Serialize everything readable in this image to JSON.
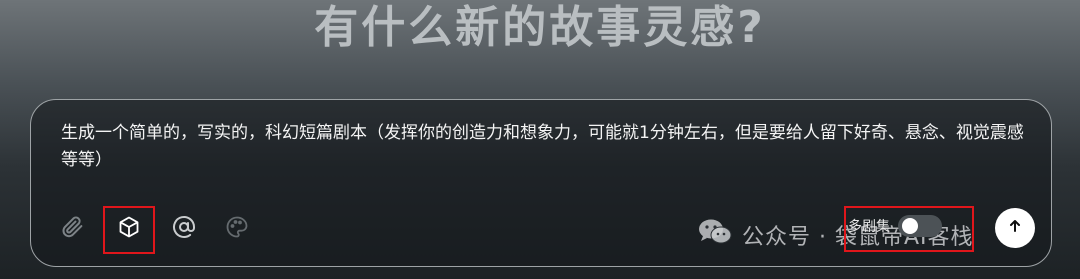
{
  "headline": "有什么新的故事灵感?",
  "composer": {
    "prompt_text": "生成一个简单的，写实的，科幻短篇剧本（发挥你的创造力和想象力，可能就1分钟左右，但是要给人留下好奇、悬念、视觉震感等等）",
    "tools": [
      {
        "icon": "paperclip-icon",
        "highlighted": false
      },
      {
        "icon": "cube-icon",
        "highlighted": true
      },
      {
        "icon": "at-sign-icon",
        "highlighted": false
      },
      {
        "icon": "palette-icon",
        "highlighted": false
      }
    ],
    "mode_toggle": {
      "label": "多剧集",
      "on": false,
      "highlighted": true
    },
    "send_icon": "arrow-up-icon"
  },
  "watermark": {
    "text": "公众号 · 袋鼠帝AI客栈",
    "icon": "wechat-icon"
  },
  "colors": {
    "highlight": "#e0161b",
    "send_button": "#ffffff"
  }
}
